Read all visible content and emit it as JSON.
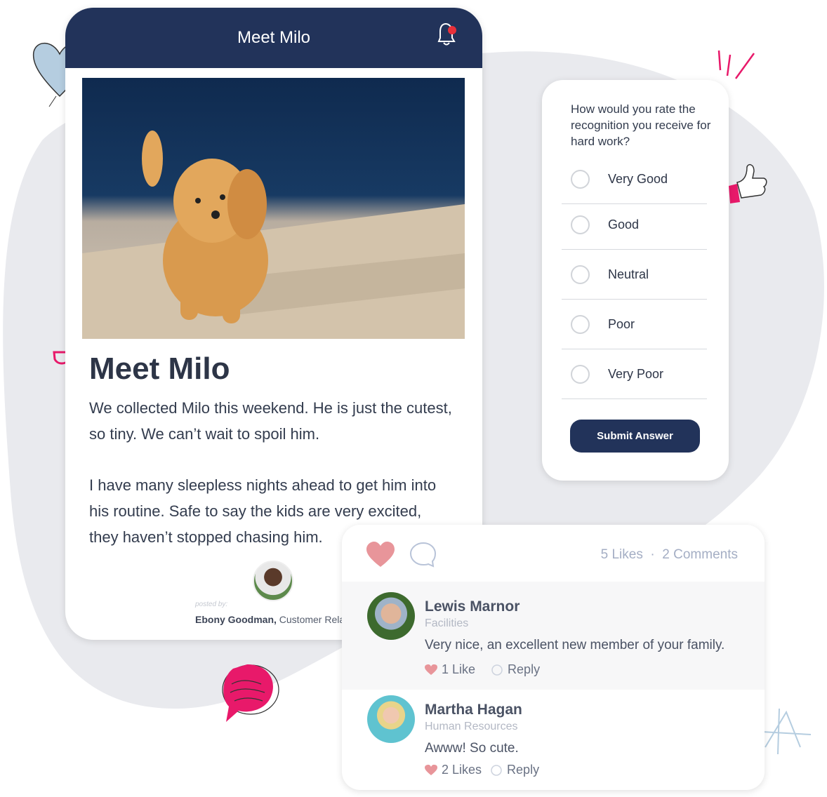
{
  "post": {
    "header_title": "Meet Milo",
    "title": "Meet Milo",
    "paragraph1": "We collected Milo this weekend. He is just the cutest, so tiny. We can’t wait to spoil him.",
    "paragraph2": "I have many sleepless nights ahead to get him into his routine. Safe to say the kids are very excited, they haven’t stopped chasing him.",
    "posted_by_label": "posted by:",
    "poster_name": "Ebony Goodman,",
    "poster_role": "Customer Relati"
  },
  "survey": {
    "question": "How would you rate the recognition you receive for hard work?",
    "options": [
      "Very Good",
      "Good",
      "Neutral",
      "Poor",
      "Very Poor"
    ],
    "submit_label": "Submit Answer"
  },
  "engagement": {
    "likes": "5 Likes",
    "separator": "·",
    "comments": "2 Comments",
    "comment_list": [
      {
        "name": "Lewis Marnor",
        "dept": "Facilities",
        "text": "Very nice, an excellent new member of your family.",
        "likes": "1 Like",
        "reply": "Reply"
      },
      {
        "name": "Martha Hagan",
        "dept": "Human Resources",
        "text": "Awww! So cute.",
        "likes": "2 Likes",
        "reply": "Reply"
      }
    ]
  },
  "colors": {
    "navy": "#22335a",
    "heart": "#e8959a",
    "accent_pink": "#e8196a",
    "blob": "#e9eaee"
  }
}
